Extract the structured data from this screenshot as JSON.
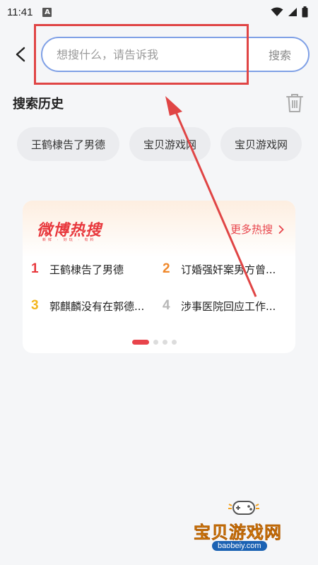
{
  "status_bar": {
    "time": "11:41",
    "notif_letter": "A"
  },
  "search": {
    "placeholder": "想搜什么，请告诉我",
    "button_label": "搜索"
  },
  "history": {
    "title": "搜索历史",
    "items": [
      "王鹤棣告了男德",
      "宝贝游戏网",
      "宝贝游戏网"
    ]
  },
  "hot": {
    "logo_text": "微博热搜",
    "logo_sub": "新鲜 · 好玩 · 有料",
    "more_label": "更多热搜",
    "items": [
      {
        "rank": "1",
        "text": "王鹤棣告了男德",
        "color": "#e8383d"
      },
      {
        "rank": "2",
        "text": "订婚强奸案男方曾...",
        "color": "#f0882a"
      },
      {
        "rank": "3",
        "text": "郭麒麟没有在郭德...",
        "color": "#f3b51c"
      },
      {
        "rank": "4",
        "text": "涉事医院回应工作...",
        "color": "#b7b7b7"
      }
    ],
    "pager": {
      "count": 4,
      "active_index": 0
    }
  },
  "watermark": {
    "title": "宝贝游戏网",
    "url": "baobeiy.com"
  },
  "colors": {
    "accent_red": "#e8444b",
    "search_border": "#7fa0e6",
    "annotation_red": "#e04545"
  }
}
